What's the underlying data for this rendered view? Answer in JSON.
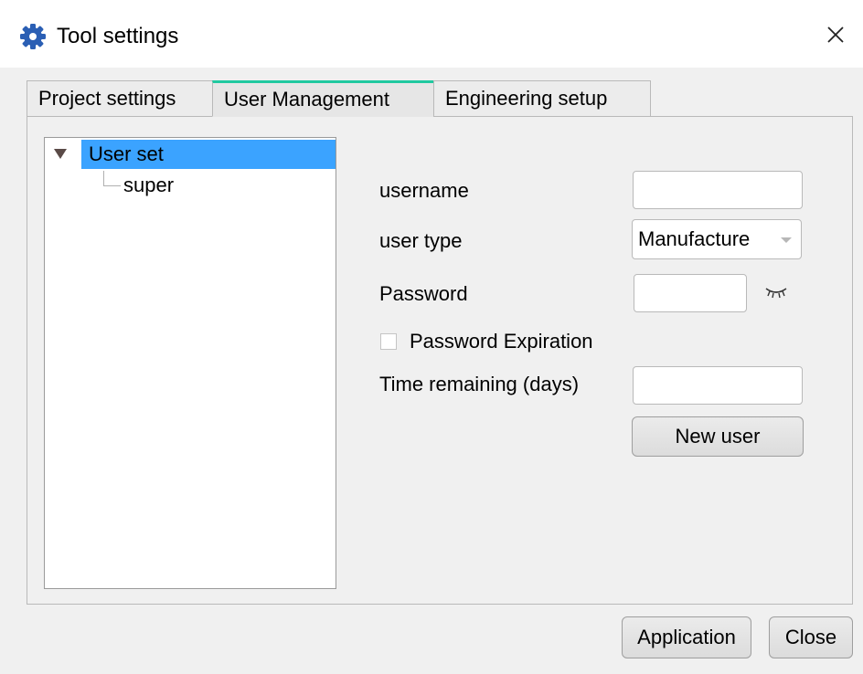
{
  "window": {
    "title": "Tool settings",
    "icon": "gear-icon",
    "close_icon": "close-icon"
  },
  "tabs": [
    {
      "label": "Project settings",
      "active": false
    },
    {
      "label": "User Management",
      "active": true
    },
    {
      "label": "Engineering setup",
      "active": false
    }
  ],
  "tree": {
    "root_label": "User set",
    "children": [
      "super"
    ]
  },
  "form": {
    "username_label": "username",
    "username_value": "",
    "user_type_label": "user type",
    "user_type_value": "Manufacture",
    "password_label": "Password",
    "password_value": "",
    "password_expiration_label": "Password Expiration",
    "password_expiration_checked": false,
    "time_remaining_label": "Time remaining (days)",
    "time_remaining_value": "",
    "new_user_button": "New user"
  },
  "footer": {
    "application_button": "Application",
    "close_button": "Close"
  },
  "colors": {
    "active_tab_accent": "#20c9a0",
    "tree_selection": "#3ba3ff",
    "title_icon": "#2b5fb4"
  }
}
